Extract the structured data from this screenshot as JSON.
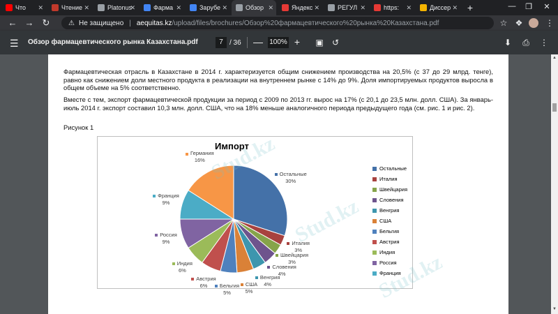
{
  "browser": {
    "tabs": [
      {
        "label": "Что",
        "color": "#ff0000"
      },
      {
        "label": "Чтение",
        "color": "#c0392b"
      },
      {
        "label": "Platonus",
        "color": "#9aa0a6"
      },
      {
        "label": "Фарма",
        "color": "#4285f4"
      },
      {
        "label": "Зарубе",
        "color": "#4285f4"
      },
      {
        "label": "Обзор",
        "color": "#9aa0a6"
      },
      {
        "label": "Яндекс",
        "color": "#e53935"
      },
      {
        "label": "РЕГУЛ",
        "color": "#9aa0a6"
      },
      {
        "label": "https:",
        "color": "#e53935"
      },
      {
        "label": "Диссер",
        "color": "#f4b400"
      }
    ],
    "active_tab_index": 5,
    "address": {
      "insecure_label": "Не защищено",
      "host": "aequitas.kz",
      "path": "/upload/files/brochures/Обзор%20фармацевтического%20рынка%20Казахстана.pdf"
    }
  },
  "pdf": {
    "title": "Обзор фармацевтического рынка Казахстана.pdf",
    "page": "7",
    "total": "/ 36",
    "zoom": "100%",
    "minus": "—",
    "plus": "+"
  },
  "document": {
    "para1": "Фармацевтическая отрасль в Казахстане в 2014 г. характеризуется общим снижением производства на 20,5% (с 37 до 29 млрд. тенге), равно как снижением доли местного продукта в реализации на внутреннем рынке с 14% до 9%. Доля импортируемых продуктов выросла в общем объеме на 5% соответственно.",
    "para2": "Вместе с тем, экспорт фармацевтической продукции за период с 2009 по 2013 гг. вырос на 17% (с 20,1 до 23,5 млн. долл. США). За январь-июль 2014 г. экспорт составил 10,3 млн. долл. США, что на 18% меньше аналогичного периода предыдущего года (см. рис. 1 и рис. 2).",
    "figure_label": "Рисунок 1"
  },
  "chart_data": {
    "type": "pie",
    "title": "Импорт",
    "legend_position": "right",
    "slices": [
      {
        "name": "Остальные",
        "value": 30,
        "label": "30%",
        "color": "#4471a8"
      },
      {
        "name": "Италия",
        "value": 3,
        "label": "3%",
        "color": "#a8423f"
      },
      {
        "name": "Швейцария",
        "value": 3,
        "label": "3%",
        "color": "#86a44a"
      },
      {
        "name": "Словения",
        "value": 4,
        "label": "4%",
        "color": "#6e548d"
      },
      {
        "name": "Венгрия",
        "value": 4,
        "label": "4%",
        "color": "#3d96ae"
      },
      {
        "name": "США",
        "value": 5,
        "label": "5%",
        "color": "#da8137"
      },
      {
        "name": "Бельгия",
        "value": 5,
        "label": "5%",
        "color": "#4f81bd"
      },
      {
        "name": "Австрия",
        "value": 6,
        "label": "6%",
        "color": "#c0504d"
      },
      {
        "name": "Индия",
        "value": 6,
        "label": "6%",
        "color": "#9bbb59"
      },
      {
        "name": "Россия",
        "value": 9,
        "label": "9%",
        "color": "#8064a2"
      },
      {
        "name": "Франция",
        "value": 9,
        "label": "9%",
        "color": "#4bacc6"
      },
      {
        "name": "Германия",
        "value": 16,
        "label": "16%",
        "color": "#f79646"
      }
    ],
    "legend": [
      "Остальные",
      "Италия",
      "Швейцария",
      "Словения",
      "Венгрия",
      "США",
      "Бельгия",
      "Австрия",
      "Индия",
      "Россия",
      "Франция"
    ]
  },
  "watermark": "Stud.kz"
}
